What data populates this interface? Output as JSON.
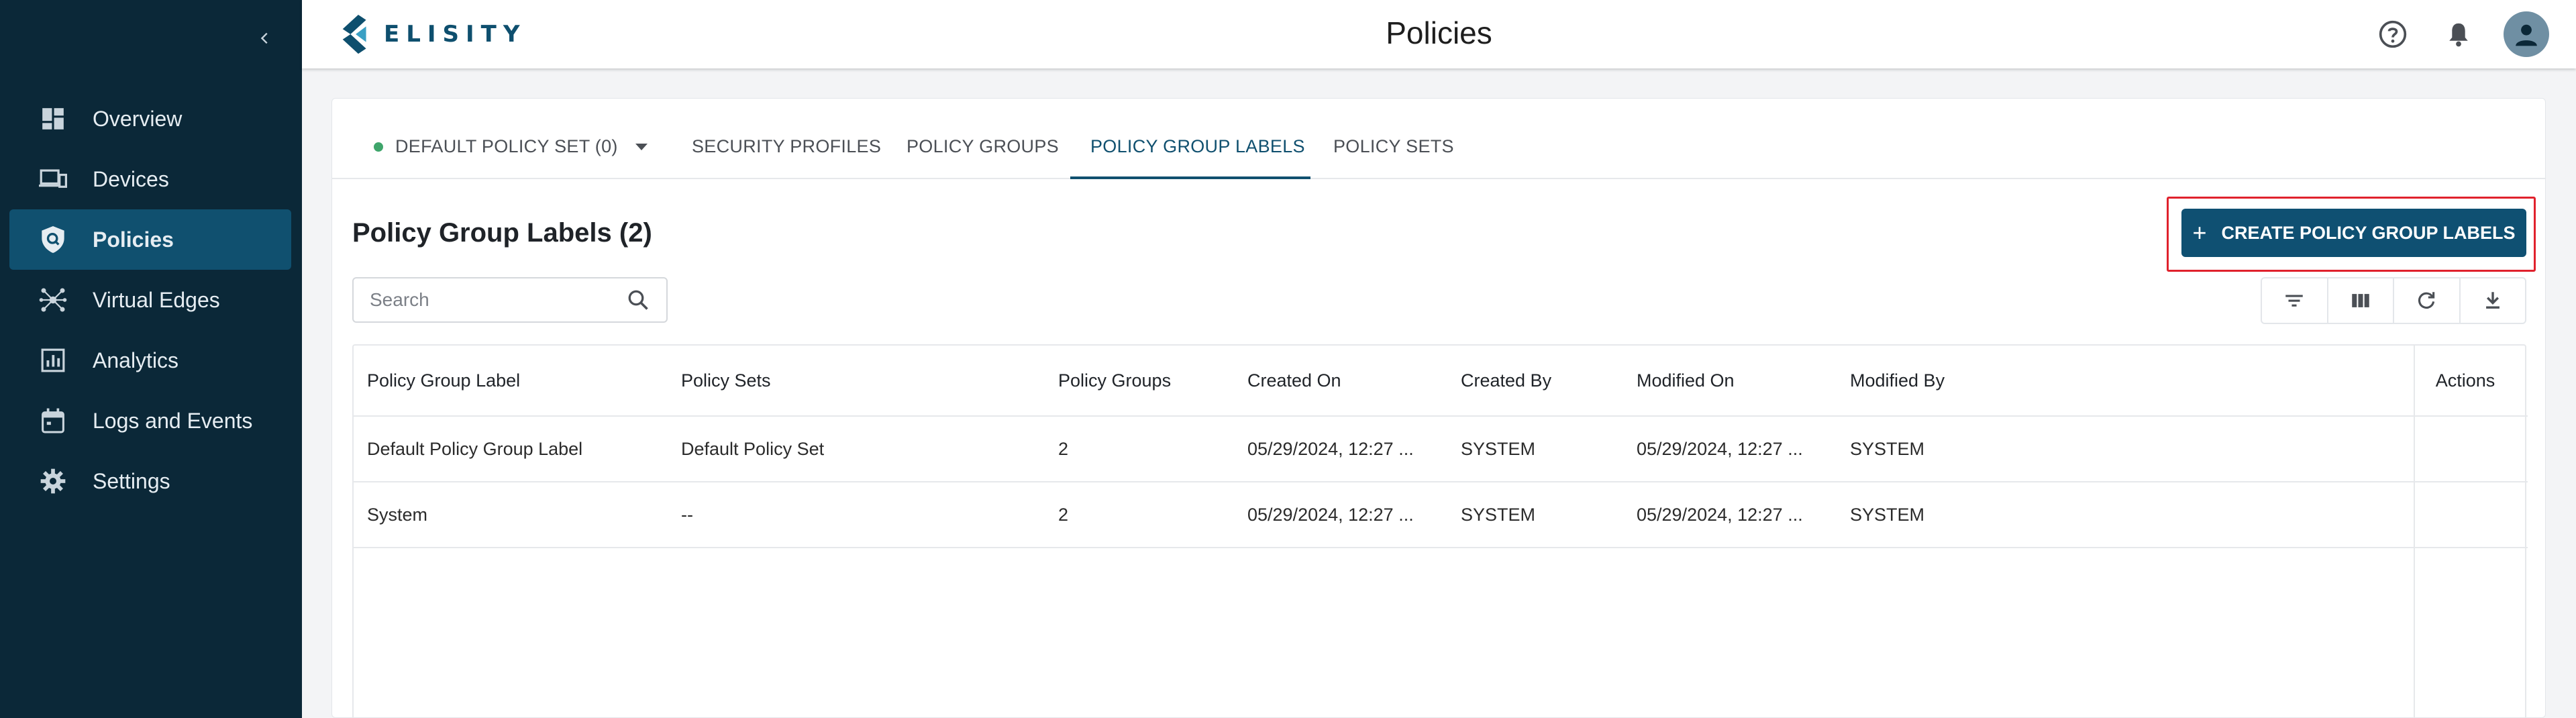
{
  "app": {
    "brand": "ELISITY",
    "page_title": "Policies"
  },
  "sidebar": {
    "items": [
      {
        "label": "Overview",
        "icon": "dashboard-icon",
        "active": false
      },
      {
        "label": "Devices",
        "icon": "devices-icon",
        "active": false
      },
      {
        "label": "Policies",
        "icon": "policy-shield-icon",
        "active": true
      },
      {
        "label": "Virtual Edges",
        "icon": "network-hub-icon",
        "active": false
      },
      {
        "label": "Analytics",
        "icon": "analytics-chart-icon",
        "active": false
      },
      {
        "label": "Logs and Events",
        "icon": "calendar-icon",
        "active": false
      },
      {
        "label": "Settings",
        "icon": "gear-icon",
        "active": false
      }
    ]
  },
  "tabs": {
    "policy_set": "DEFAULT POLICY SET (0)",
    "items": [
      "SECURITY PROFILES",
      "POLICY GROUPS",
      "POLICY GROUP LABELS",
      "POLICY SETS"
    ],
    "active": "POLICY GROUP LABELS"
  },
  "section": {
    "title": "Policy Group Labels (2)",
    "create_label": "CREATE POLICY GROUP LABELS",
    "search_placeholder": "Search"
  },
  "table": {
    "columns": [
      "Policy Group Label",
      "Policy Sets",
      "Policy Groups",
      "Created On",
      "Created By",
      "Modified On",
      "Modified By",
      "Actions"
    ],
    "rows": [
      [
        "Default Policy Group Label",
        "Default Policy Set",
        "2",
        "05/29/2024, 12:27 ...",
        "SYSTEM",
        "05/29/2024, 12:27 ...",
        "SYSTEM"
      ],
      [
        "System",
        "--",
        "2",
        "05/29/2024, 12:27 ...",
        "SYSTEM",
        "05/29/2024, 12:27 ...",
        "SYSTEM"
      ]
    ]
  },
  "colors": {
    "sidebar_bg": "#0b2838",
    "sidebar_active": "#10506f",
    "primary": "#0f5072",
    "highlight": "#e0222d",
    "status_green": "#3fa56b"
  }
}
